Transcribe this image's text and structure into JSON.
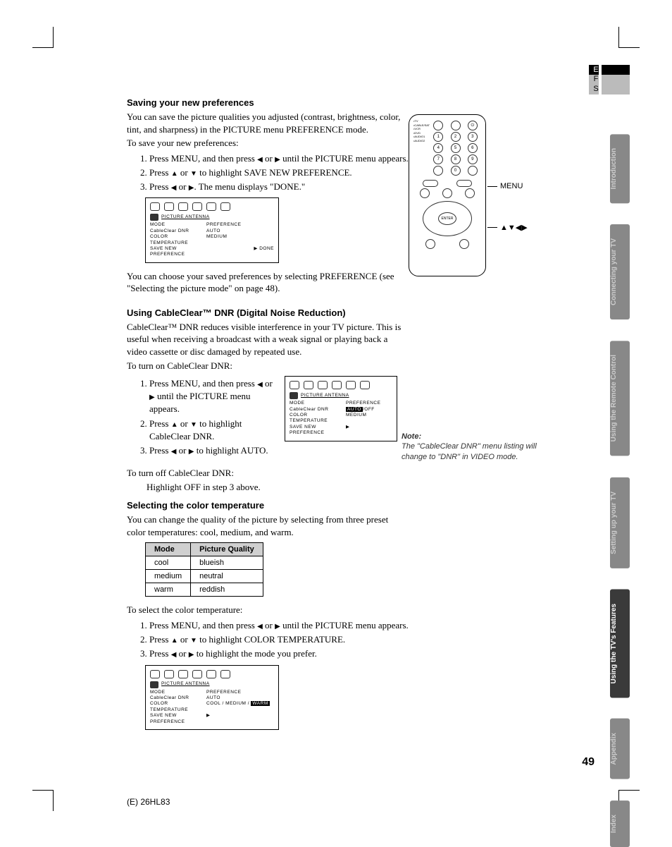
{
  "lang": {
    "e": "E",
    "f": "F",
    "s": "S"
  },
  "sideTabs": [
    "Introduction",
    "Connecting your TV",
    "Using the Remote Control",
    "Setting up your TV",
    "Using the TV's Features",
    "Appendix",
    "Index"
  ],
  "s1": {
    "h": "Saving your new preferences",
    "p1": "You can save the picture qualities you adjusted (contrast, brightness, color, tint, and sharpness) in the PICTURE menu PREFERENCE mode.",
    "p2": "To save your new preferences:",
    "li1a": "Press MENU, and then press ",
    "li1b": " or ",
    "li1c": " until the PICTURE menu appears.",
    "li2a": "Press ",
    "li2b": " or ",
    "li2c": " to highlight SAVE NEW PREFERENCE.",
    "li3a": "Press ",
    "li3b": " or ",
    "li3c": ". The menu displays \"DONE.\"",
    "p3": "You can choose your saved preferences by selecting PREFERENCE (see \"Selecting the picture mode\" on page 48)."
  },
  "menu1": {
    "hdr": "PICTURE   ANTENNA",
    "r1a": "MODE",
    "r1b": "PREFERENCE",
    "r2a": "CableClear  DNR",
    "r2b": "AUTO",
    "r3a": "COLOR\nTEMPERATURE",
    "r3b": "MEDIUM",
    "r4a": "SAVE NEW  PREFERENCE",
    "r4b": "▶  DONE"
  },
  "remote": {
    "menuLabel": "MENU",
    "arrowsLabel": "▲▼◀▶",
    "enter": "ENTER"
  },
  "s2": {
    "h": "Using CableClear™ DNR (Digital Noise Reduction)",
    "p1": "CableClear™ DNR reduces visible interference in your TV picture. This is useful when receiving a broadcast with a weak signal or playing back a video cassette or disc damaged by repeated use.",
    "p2": "To turn on CableClear DNR:",
    "li1a": "Press MENU, and then press ",
    "li1b": " or ",
    "li1c": " until the PICTURE menu appears.",
    "li2a": "Press ",
    "li2b": " or ",
    "li2c": " to highlight CableClear DNR.",
    "li3a": "Press ",
    "li3b": " or ",
    "li3c": " to highlight AUTO.",
    "p3": "To turn off CableClear DNR:",
    "p4": "Highlight OFF in step 3 above."
  },
  "menu2": {
    "hdr": "PICTURE   ANTENNA",
    "r1a": "MODE",
    "r1b": "PREFERENCE",
    "r2a": "CableClear  DNR",
    "r2b": "AUTO",
    "r2c": "/OFF",
    "r3a": "COLOR\nTEMPERATURE",
    "r3b": "MEDIUM",
    "r4a": "SAVE NEW  PREFERENCE",
    "r4b": "▶"
  },
  "note": {
    "h": "Note:",
    "p": "The \"CableClear DNR\" menu listing will change to \"DNR\" in VIDEO mode."
  },
  "s3": {
    "h": "Selecting the color temperature",
    "p1": "You can change the quality of the picture by selecting from three preset color temperatures: cool, medium, and warm.",
    "th1": "Mode",
    "th2": "Picture Quality",
    "rows": [
      {
        "m": "cool",
        "q": "blueish"
      },
      {
        "m": "medium",
        "q": "neutral"
      },
      {
        "m": "warm",
        "q": "reddish"
      }
    ],
    "p2": "To select the color temperature:",
    "li1a": "Press MENU, and then press ",
    "li1b": " or ",
    "li1c": " until the PICTURE menu appears.",
    "li2a": "Press ",
    "li2b": " or ",
    "li2c": " to highlight COLOR TEMPERATURE.",
    "li3a": "Press ",
    "li3b": " or ",
    "li3c": " to highlight the mode you prefer."
  },
  "menu3": {
    "hdr": "PICTURE   ANTENNA",
    "r1a": "MODE",
    "r1b": "PREFERENCE",
    "r2a": "CableClear  DNR",
    "r2b": "AUTO",
    "r3a": "COLOR\nTEMPERATURE",
    "r3b": "COOL / MEDIUM /",
    "r3c": "WARM",
    "r4a": "SAVE NEW  PREFERENCE",
    "r4b": "▶"
  },
  "pageNum": "49",
  "footer": "(E) 26HL83"
}
